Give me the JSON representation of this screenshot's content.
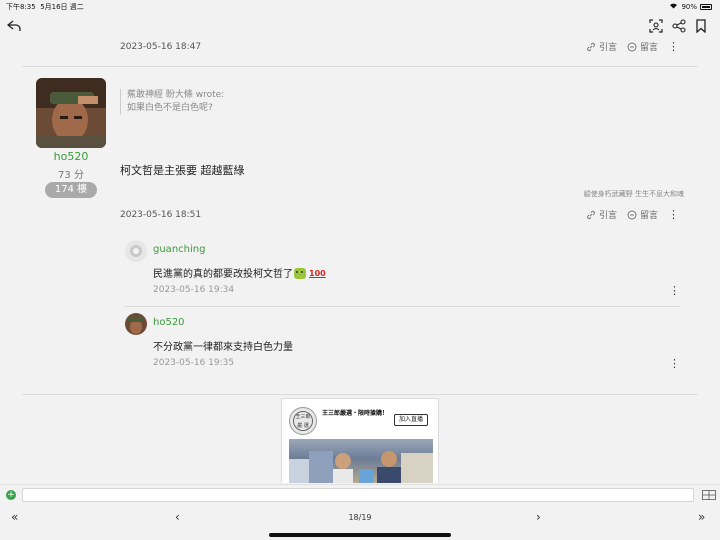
{
  "status_bar": {
    "time": "下午8:35",
    "date": "5月16日 週二",
    "battery": "90%"
  },
  "colors": {
    "accent_green": "#3a9a3a",
    "background": "#f2f2f2",
    "badge_gray": "#a9a9a9"
  },
  "nav": {
    "back_icon": "reply-back-icon",
    "icons": [
      "scan-icon",
      "share-icon",
      "bookmark-icon"
    ]
  },
  "posts": [
    {
      "date": "2023-05-16 18:47",
      "actions": {
        "quote": "引言",
        "reply": "留言"
      }
    },
    {
      "author": {
        "name": "ho520",
        "score": "73 分",
        "floor": "174 樓"
      },
      "quote": {
        "header": "蕉敢神經 盼大條 wrote:",
        "text": "如果白色不是白色呢?"
      },
      "body": "柯文哲是主張要 超越藍綠",
      "signature": "縱使身朽武藏野 生生不息大和魂",
      "date": "2023-05-16 18:51",
      "actions": {
        "quote": "引言",
        "reply": "留言"
      },
      "replies": [
        {
          "name": "guanching",
          "text": "民進黨的真的都要改投柯文哲了",
          "badge": "100",
          "date": "2023-05-16 19:34"
        },
        {
          "name": "ho520",
          "text": "不分政黨一律都來支持白色力量",
          "date": "2023-05-16 19:35"
        }
      ]
    }
  ],
  "ad": {
    "logo_line1": "王三郎",
    "logo_line2": "嚴 選",
    "title": "王三郎嚴選・限時搶購！",
    "cta": "加入直播"
  },
  "input": {
    "placeholder": ""
  },
  "pagination": {
    "current": "18/19",
    "first": "«",
    "prev": "‹",
    "next": "›",
    "last": "»"
  }
}
